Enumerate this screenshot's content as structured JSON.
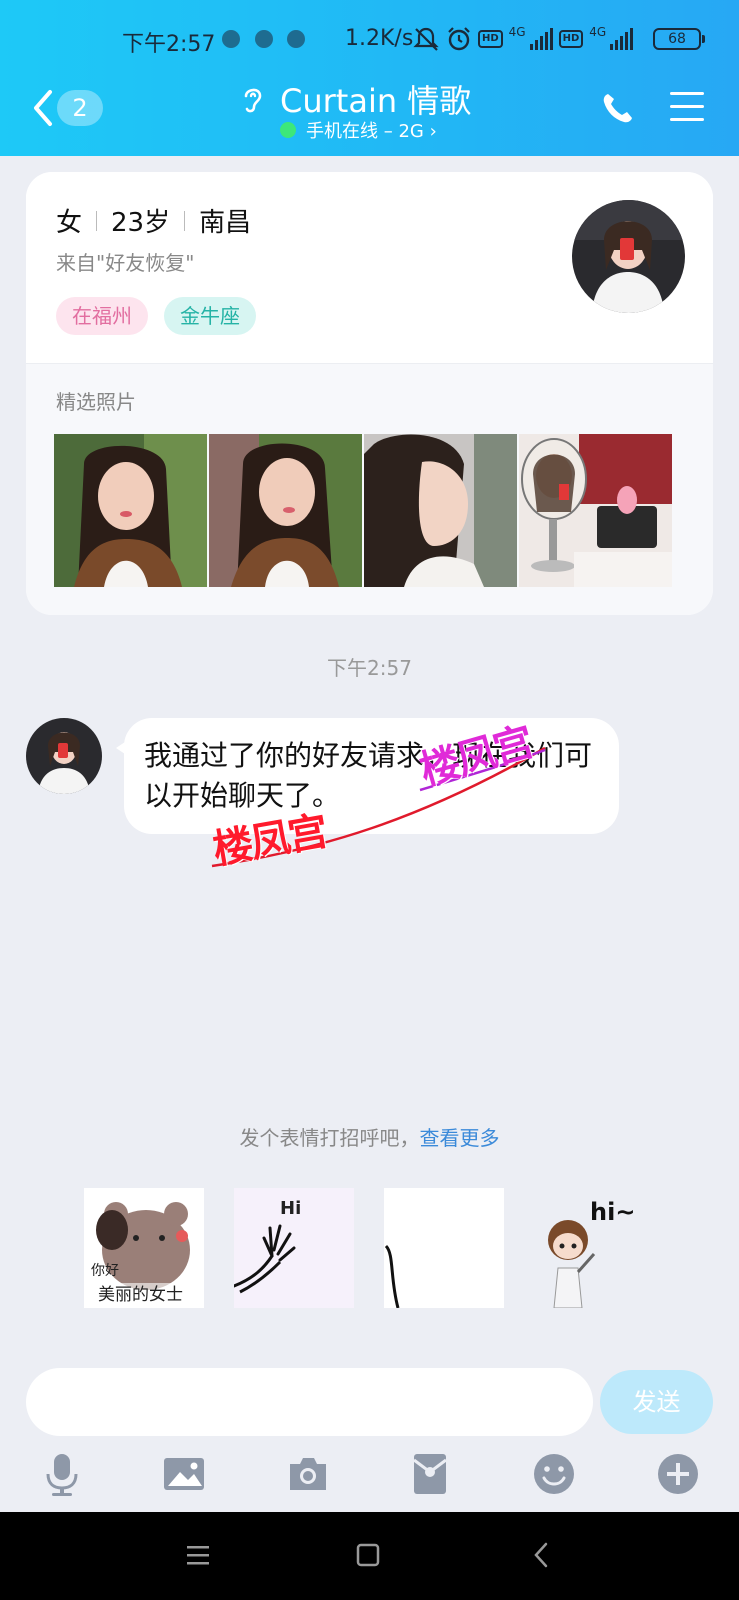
{
  "status_bar": {
    "time": "下午2:57",
    "speed": "1.2K/s",
    "network_1": "4G",
    "network_2": "4G",
    "hd_1": "HD",
    "hd_2": "HD",
    "battery": "68"
  },
  "header": {
    "unread_count": "2",
    "title": "Curtain 情歌",
    "subtitle": "手机在线 – 2G ›",
    "online_color": "#3de77a"
  },
  "profile": {
    "gender": "女",
    "age": "23岁",
    "city": "南昌",
    "source": "来自\"好友恢复\"",
    "tags": [
      "在福州",
      "金牛座"
    ],
    "photos_title": "精选照片"
  },
  "chat": {
    "timestamp": "下午2:57",
    "message": "我通过了你的好友请求，现在我们可以开始聊天了。",
    "watermark": "楼凤宫"
  },
  "stickers": {
    "hint": "发个表情打招呼吧，",
    "hint_link": "查看更多",
    "sticker_1_text_a": "你好",
    "sticker_1_text_b": "美丽的女士",
    "sticker_2_text": "Hi",
    "sticker_4_text": "hi~"
  },
  "composer": {
    "input_value": "",
    "send_label": "发送"
  },
  "toolbar_icons": [
    "mic-icon",
    "image-icon",
    "camera-icon",
    "red-packet-icon",
    "emoji-icon",
    "plus-icon"
  ],
  "colors": {
    "header_gradient_start": "#1ec9f7",
    "header_gradient_end": "#27a8f4",
    "send_button": "#bde9fb",
    "link": "#3b8ad9"
  }
}
